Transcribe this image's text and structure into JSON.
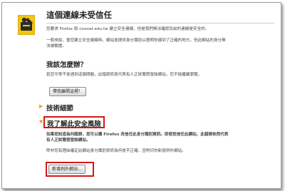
{
  "colors": {
    "highlight": "#d0191a",
    "arrow": "#f0a020",
    "icon_yellow": "#f1c40f"
  },
  "header": {
    "icon": "warning-badge-icon",
    "title": "這個連線未受信任"
  },
  "intro": {
    "line1": "您要求 Firefox 和 cissnet.edu.tw 建立安全連線，但是我們無法確認目前的連線是安全的。",
    "line2": "一般來說，當您建立安全連線時，網站會提供身分識別以證明你連到了正確的地方。但此網站的身分無",
    "line3": "法被驗證。"
  },
  "what_to_do": {
    "heading": "我該怎麼辦？",
    "text": "若您平常不會遇到這個問題，此錯誤訊息代表有人正試著假冒該網站，您不該繼續瀏覽。",
    "button": "帶我離開這裡！"
  },
  "technical": {
    "heading": "技術細節"
  },
  "risk": {
    "heading": "我了解此安全風險",
    "line1": "如果您知道為何錯誤，您可以讓 Firefox 改信任此身分識別資訊。即使您信任此網站，此錯誤依然代表",
    "line2": "有人正試著假冒該網站。",
    "line3": "除非您有理由確定此網站身分識別資訊為何會不正確，否則切勿新增例外網站。",
    "button": "新增例外網站..."
  }
}
